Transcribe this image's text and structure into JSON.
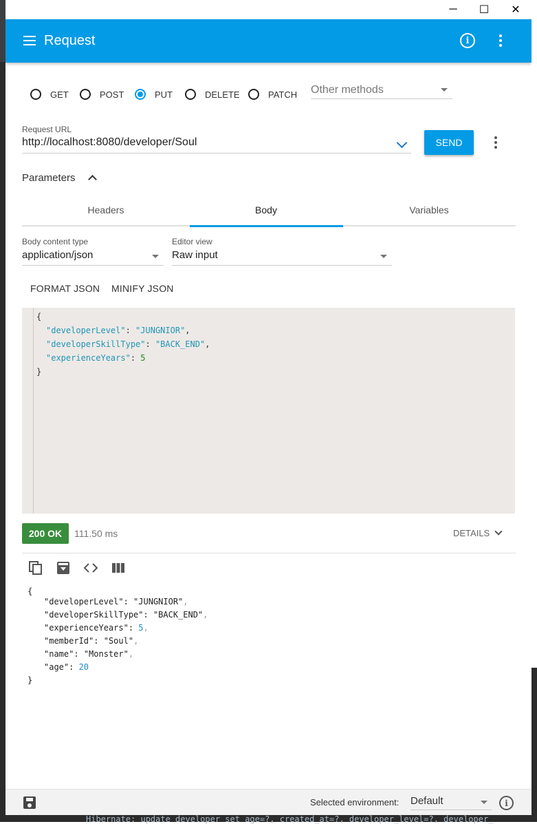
{
  "window": {
    "minimize": "─",
    "maximize": "☐",
    "close": "✕"
  },
  "appbar": {
    "title": "Request",
    "menu_icon": "hamburger-icon",
    "info_icon": "info-icon",
    "more_icon": "more-vert-icon"
  },
  "methods": {
    "options": [
      "GET",
      "POST",
      "PUT",
      "DELETE",
      "PATCH"
    ],
    "selected": "PUT",
    "other_placeholder": "Other methods"
  },
  "url": {
    "label": "Request URL",
    "value": "http://localhost:8080/developer/Soul",
    "send": "SEND"
  },
  "parameters": {
    "label": "Parameters",
    "tabs": [
      "Headers",
      "Body",
      "Variables"
    ],
    "active_tab": "Body"
  },
  "body": {
    "content_type_label": "Body content type",
    "content_type": "application/json",
    "editor_view_label": "Editor view",
    "editor_view": "Raw input",
    "format_json": "FORMAT JSON",
    "minify_json": "MINIFY JSON",
    "raw": {
      "open": "{",
      "lines": [
        {
          "key": "\"developerLevel\"",
          "sep": ": ",
          "value": "\"JUNGNIOR\"",
          "trail": ","
        },
        {
          "key": "\"developerSkillType\"",
          "sep": ": ",
          "value": "\"BACK_END\"",
          "trail": ","
        },
        {
          "key": "\"experienceYears\"",
          "sep": ": ",
          "value": "5",
          "trail": ""
        }
      ],
      "close": "}"
    }
  },
  "response": {
    "status": "200 OK",
    "time": "111.50 ms",
    "details": "DETAILS",
    "json": {
      "open": "{",
      "lines": [
        {
          "key": "\"developerLevel\"",
          "sep": ": ",
          "value": "\"JUNGNIOR\"",
          "trail": ","
        },
        {
          "key": "\"developerSkillType\"",
          "sep": ": ",
          "value": "\"BACK_END\"",
          "trail": ","
        },
        {
          "key": "\"experienceYears\"",
          "sep": ": ",
          "value": "5",
          "trail": ","
        },
        {
          "key": "\"memberId\"",
          "sep": ": ",
          "value": "\"Soul\"",
          "trail": ","
        },
        {
          "key": "\"name\"",
          "sep": ": ",
          "value": "\"Monster\"",
          "trail": ","
        },
        {
          "key": "\"age\"",
          "sep": ": ",
          "value": "20",
          "trail": ""
        }
      ],
      "close": "}"
    }
  },
  "footer": {
    "env_label": "Selected environment:",
    "env_value": "Default"
  },
  "background_text": "Hibernate: update developer set age=?, created_at=?, developer_level=?, developer_"
}
